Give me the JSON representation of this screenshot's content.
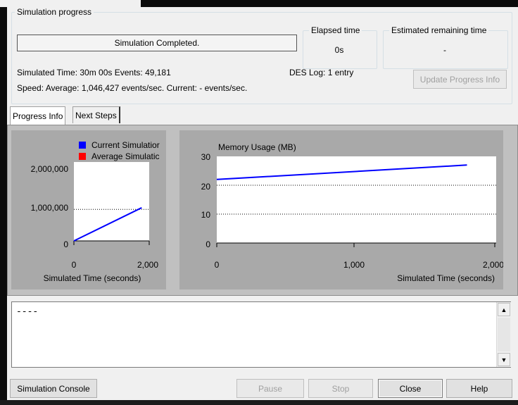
{
  "progress_group": {
    "legend": "Simulation progress",
    "status": "Simulation Completed.",
    "elapsed_legend": "Elapsed time",
    "elapsed_value": "0s",
    "remaining_legend": "Estimated remaining time",
    "remaining_value": "-",
    "simulated_time_line": "Simulated Time: 30m 00s  Events: 49,181",
    "des_log": "DES Log: 1 entry",
    "speed_line": "Speed: Average: 1,046,427 events/sec. Current: - events/sec.",
    "update_button": "Update Progress Info"
  },
  "tabs": [
    {
      "label": "Progress Info",
      "active": true
    },
    {
      "label": "Next Steps",
      "active": false
    }
  ],
  "events_chart": {
    "legend": [
      "Current Simulation",
      "Average Simulation"
    ],
    "legend_visible": [
      "Current Simulatior",
      "Average Simulatic"
    ],
    "xlabel": "Simulated Time (seconds)",
    "y_ticks": [
      "0",
      "1,000,000",
      "2,000,000"
    ],
    "x_ticks": [
      "0",
      "2,000"
    ]
  },
  "memory_chart": {
    "title": "Memory Usage (MB)",
    "xlabel": "Simulated Time (seconds)",
    "y_ticks": [
      "0",
      "10",
      "20",
      "30"
    ],
    "x_ticks": [
      "0",
      "1,000",
      "2,000"
    ]
  },
  "chart_data": [
    {
      "type": "line",
      "series": [
        {
          "name": "Current Simulation",
          "color": "#0000ff",
          "x": [
            0,
            1800
          ],
          "y": [
            0,
            1050000
          ]
        },
        {
          "name": "Average Simulation",
          "color": "#ff0000",
          "x": [],
          "y": []
        }
      ],
      "xlabel": "Simulated Time (seconds)",
      "xlim": [
        0,
        2000
      ],
      "ylim": [
        0,
        2500000
      ],
      "gridlines_y": [
        1000000,
        2000000
      ]
    },
    {
      "type": "line",
      "title": "Memory Usage (MB)",
      "series": [
        {
          "color": "#0000ff",
          "x": [
            0,
            1800
          ],
          "y": [
            22,
            27
          ]
        }
      ],
      "xlabel": "Simulated Time (seconds)",
      "xlim": [
        0,
        2000
      ],
      "ylim": [
        0,
        30
      ],
      "gridlines_y": [
        10,
        20
      ]
    }
  ],
  "log": {
    "text": "----"
  },
  "footer": {
    "console_button": "Simulation Console",
    "pause_button": "Pause",
    "stop_button": "Stop",
    "close_button": "Close",
    "help_button": "Help"
  },
  "colors": {
    "accent_series": "#0000ff",
    "avg_series": "#ff0000",
    "chart_bg": "#a9a9a9"
  }
}
